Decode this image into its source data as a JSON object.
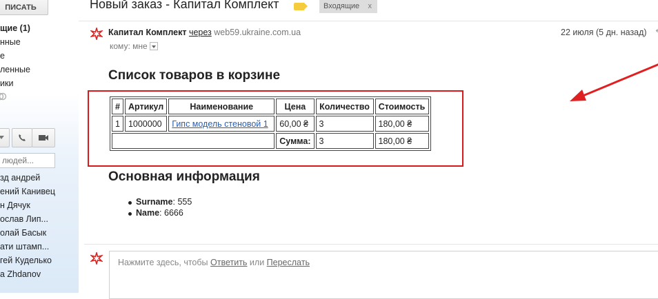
{
  "sidebar": {
    "compose_label": "ПИСАТЬ",
    "nav": [
      "щие (1)",
      "нные",
      "е",
      "ленные",
      "ики"
    ],
    "chat": {
      "search_placeholder": "людей...",
      "contacts": [
        "зд андрей",
        "ений Канивец",
        "н Дячук",
        "ослав Лип...",
        "олай Басык",
        "ати штамп...",
        "гей Куделько",
        "a Zhdanov"
      ]
    }
  },
  "header": {
    "subject": "Новый заказ - Капитал Комплект",
    "label_chip": "Входящие",
    "label_chip_close": "x",
    "label_color": "#f5cc3d"
  },
  "message": {
    "sender": "Капитал Комплект",
    "via_word": "через",
    "via_domain": "web59.ukraine.com.ua",
    "recipient": "кому: мне",
    "date": "22 июля (5 дн. назад)",
    "star_color": "#dd2222"
  },
  "cart": {
    "heading": "Список товаров в корзине",
    "columns": [
      "#",
      "Артикул",
      "Наименование",
      "Цена",
      "Количество",
      "Стоимость"
    ],
    "rows": [
      {
        "n": "1",
        "sku": "1000000",
        "name": "Гипс модель стеновой 1",
        "price": "60,00 ₴",
        "qty": "3",
        "cost": "180,00 ₴"
      }
    ],
    "total": {
      "label": "Сумма:",
      "qty": "3",
      "cost": "180,00 ₴"
    }
  },
  "info": {
    "heading": "Основная информация",
    "items": [
      {
        "key": "Surname",
        "value": ": 555"
      },
      {
        "key": "Name",
        "value": ": 6666"
      }
    ]
  },
  "reply": {
    "prompt": "Нажмите здесь, чтобы ",
    "reply_link": "Ответить",
    "or": " или ",
    "forward_link": "Переслать"
  },
  "annotation": {
    "color": "#e02020"
  }
}
